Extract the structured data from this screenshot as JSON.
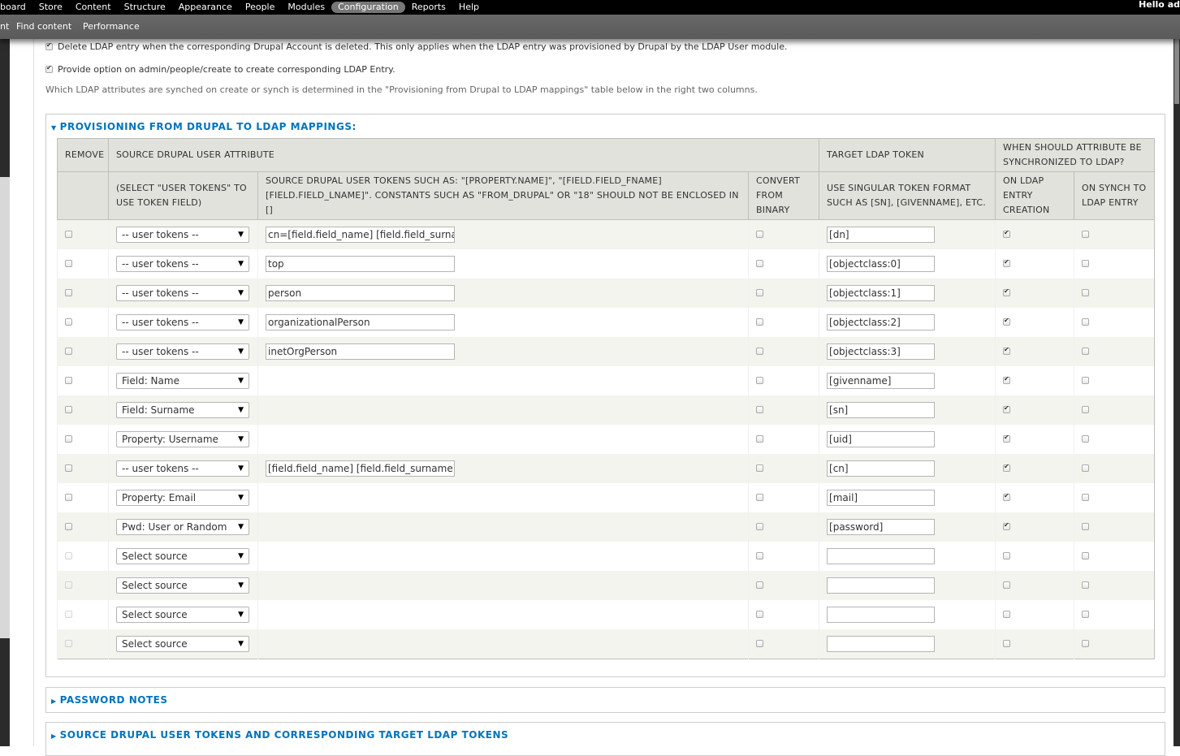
{
  "toolbar": {
    "items": [
      "board",
      "Store",
      "Content",
      "Structure",
      "Appearance",
      "People",
      "Modules",
      "Configuration",
      "Reports",
      "Help"
    ],
    "active": "Configuration",
    "hello": "Hello ad"
  },
  "shortcuts": [
    "nt",
    "Find content",
    "Performance"
  ],
  "options": {
    "delete_label": "Delete LDAP entry when the corresponding Drupal Account is deleted.  This only applies when the LDAP entry was provisioned by Drupal by the LDAP User module.",
    "delete_checked": true,
    "provide_label": "Provide option on admin/people/create to create corresponding LDAP Entry.",
    "provide_checked": true,
    "description": "Which LDAP attributes are synched on create or synch is determined in the \"Provisioning from Drupal to LDAP mappings\" table below in the right two columns."
  },
  "mappings": {
    "legend": "PROVISIONING FROM DRUPAL TO LDAP MAPPINGS:",
    "headers": {
      "remove": "REMOVE",
      "source_attr": "SOURCE DRUPAL USER ATTRIBUTE",
      "target_token": "TARGET LDAP TOKEN",
      "when_sync": "WHEN SHOULD ATTRIBUTE BE SYNCHRONIZED TO LDAP?",
      "select_user_tokens": "(SELECT \"USER TOKENS\" TO USE TOKEN FIELD)",
      "source_tokens": "SOURCE DRUPAL USER TOKENS SUCH AS: \"[PROPERTY.NAME]\", \"[FIELD.FIELD_FNAME] [FIELD.FIELD_LNAME]\". CONSTANTS SUCH AS \"FROM_DRUPAL\" OR \"18\" SHOULD NOT BE ENCLOSED IN []",
      "convert_binary": "CONVERT FROM BINARY",
      "singular_token": "USE SINGULAR TOKEN FORMAT SUCH AS [SN], [GIVENNAME], ETC.",
      "on_creation": "ON LDAP ENTRY CREATION",
      "on_synch": "ON SYNCH TO LDAP ENTRY"
    },
    "rows": [
      {
        "source": "-- user tokens --",
        "token": "cn=[field.field_name] [field.field_surname]",
        "target": "[dn]",
        "on_create": true
      },
      {
        "source": "-- user tokens --",
        "token": "top",
        "target": "[objectclass:0]",
        "on_create": true
      },
      {
        "source": "-- user tokens --",
        "token": "person",
        "target": "[objectclass:1]",
        "on_create": true
      },
      {
        "source": "-- user tokens --",
        "token": "organizationalPerson",
        "target": "[objectclass:2]",
        "on_create": true
      },
      {
        "source": "-- user tokens --",
        "token": "inetOrgPerson",
        "target": "[objectclass:3]",
        "on_create": true
      },
      {
        "source": "Field: Name",
        "token": null,
        "target": "[givenname]",
        "on_create": true
      },
      {
        "source": "Field: Surname",
        "token": null,
        "target": "[sn]",
        "on_create": true
      },
      {
        "source": "Property: Username",
        "token": null,
        "target": "[uid]",
        "on_create": true
      },
      {
        "source": "-- user tokens --",
        "token": "[field.field_name] [field.field_surname]",
        "target": "[cn]",
        "on_create": true
      },
      {
        "source": "Property: Email",
        "token": null,
        "target": "[mail]",
        "on_create": true
      },
      {
        "source": "Pwd: User or Random",
        "token": null,
        "target": "[password]",
        "on_create": true
      },
      {
        "source": "Select source",
        "token": null,
        "target": "",
        "on_create": false,
        "empty": true
      },
      {
        "source": "Select source",
        "token": null,
        "target": "",
        "on_create": false,
        "empty": true
      },
      {
        "source": "Select source",
        "token": null,
        "target": "",
        "on_create": false,
        "empty": true
      },
      {
        "source": "Select source",
        "token": null,
        "target": "",
        "on_create": false,
        "empty": true
      }
    ]
  },
  "password_notes": {
    "legend": "PASSWORD NOTES"
  },
  "tokens_section": {
    "legend": "SOURCE DRUPAL USER TOKENS AND CORRESPONDING TARGET LDAP TOKENS"
  },
  "colors": {
    "link": "#0074bd",
    "header_bg": "#e1e2dc",
    "row_odd": "#f3f4ee"
  }
}
